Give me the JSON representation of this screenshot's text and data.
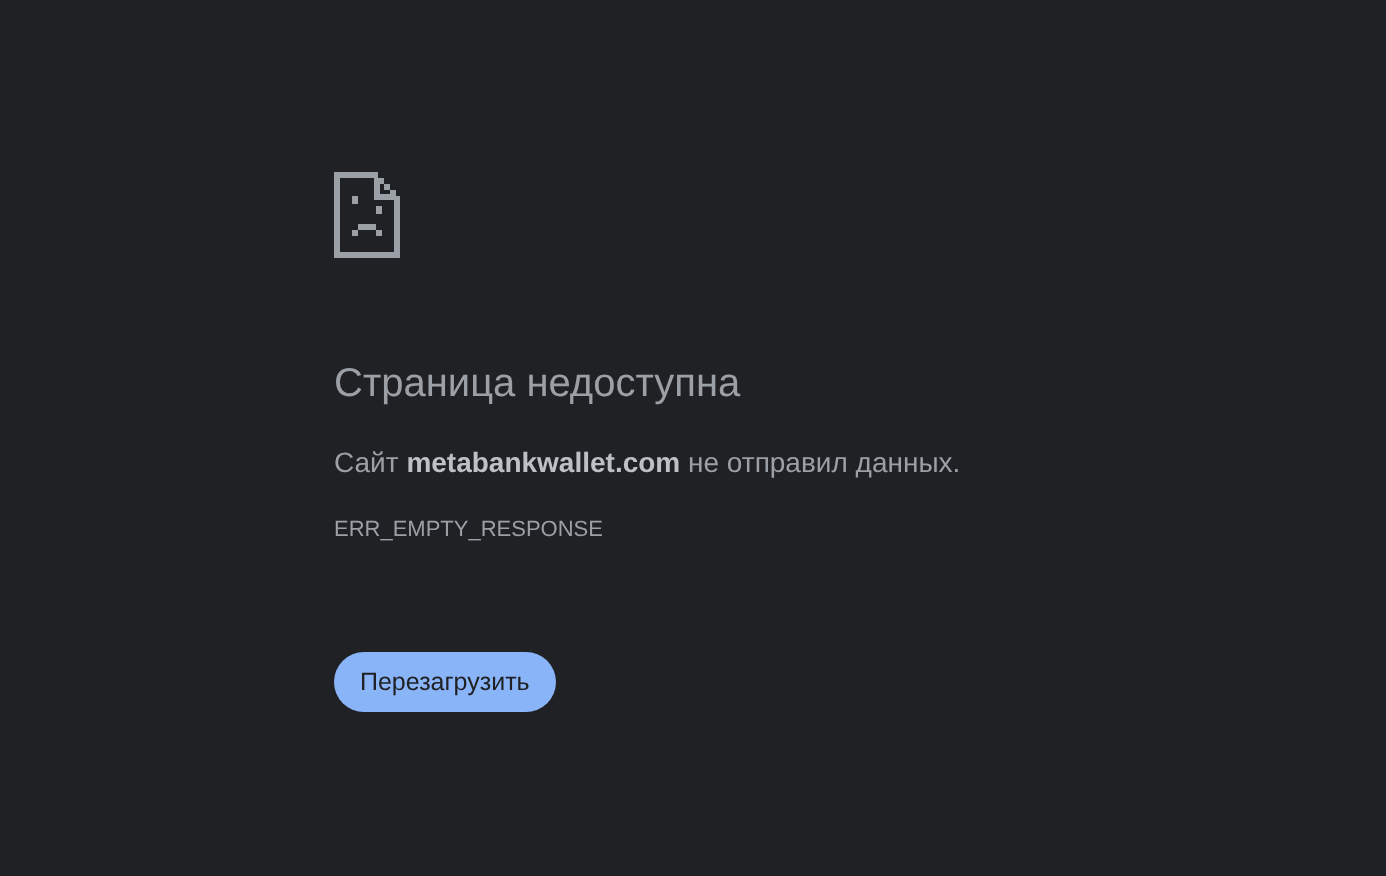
{
  "title": "Страница недоступна",
  "message": "Сайт **metabankwallet.com** не отправил данных.",
  "error_code": "ERR_EMPTY_RESPONSE",
  "button": {
    "label": "Перезагрузить"
  }
}
